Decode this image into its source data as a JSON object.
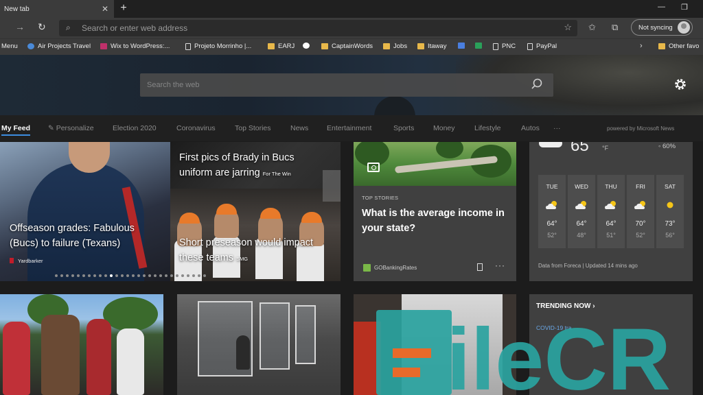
{
  "browser": {
    "tab_title": "New tab",
    "omnibox_placeholder": "Search or enter web address",
    "sync_label": "Not syncing"
  },
  "favorites": [
    {
      "label": "Menu",
      "icon": "none"
    },
    {
      "label": "Air Projects Travel",
      "icon": "air"
    },
    {
      "label": "Wix to WordPress:...",
      "icon": "wix"
    },
    {
      "label": "Projeto Morrinho |...",
      "icon": "page"
    },
    {
      "label": "EARJ",
      "icon": "folder"
    },
    {
      "label": "",
      "icon": "google"
    },
    {
      "label": "CaptainWords",
      "icon": "folder"
    },
    {
      "label": "Jobs",
      "icon": "folder"
    },
    {
      "label": "Itaway",
      "icon": "folder"
    },
    {
      "label": "",
      "icon": "docs"
    },
    {
      "label": "",
      "icon": "sheets"
    },
    {
      "label": "PNC",
      "icon": "page"
    },
    {
      "label": "PayPal",
      "icon": "page"
    },
    {
      "label": "Other favo",
      "icon": "folder"
    }
  ],
  "hero": {
    "search_placeholder": "Search the web"
  },
  "feed_nav": {
    "items": [
      "My Feed",
      "Personalize",
      "Election 2020",
      "Coronavirus",
      "Top Stories",
      "News",
      "Entertainment",
      "Sports",
      "Money",
      "Lifestyle",
      "Autos",
      "···"
    ],
    "active_index": 0,
    "powered_by": "powered by Microsoft News"
  },
  "carousel": {
    "left_title": "Offseason grades: Fabulous (Bucs) to failure (Texans)",
    "left_source": "Yardbarker",
    "top_right_title": "First pics of Brady in Bucs uniform are jarring",
    "top_right_source": "For The Win",
    "bottom_right_title": "Short preseason would impact these teams",
    "bottom_right_source": "SMG",
    "dot_count": 28,
    "active_dot": 10
  },
  "top_story": {
    "label": "TOP STORIES",
    "title": "What is the average income in your state?",
    "source": "GOBankingRates"
  },
  "weather": {
    "current_temp": "65",
    "current_unit": "°F",
    "humidity": "60%",
    "days": [
      {
        "name": "TUE",
        "icon": "partly-cloudy",
        "hi": "64°",
        "lo": "52°"
      },
      {
        "name": "WED",
        "icon": "partly-cloudy",
        "hi": "64°",
        "lo": "48°"
      },
      {
        "name": "THU",
        "icon": "partly-cloudy",
        "hi": "64°",
        "lo": "51°"
      },
      {
        "name": "FRI",
        "icon": "partly-cloudy",
        "hi": "70°",
        "lo": "52°"
      },
      {
        "name": "SAT",
        "icon": "sunny",
        "hi": "73°",
        "lo": "56°"
      }
    ],
    "footer": "Data from Foreca | Updated 14 mins ago"
  },
  "trending": {
    "heading": "TRENDING NOW",
    "chevron": "›",
    "first_item": "COVID-19 tra"
  },
  "watermark": {
    "text": "FileCR",
    "color": "#2aa3a0"
  }
}
